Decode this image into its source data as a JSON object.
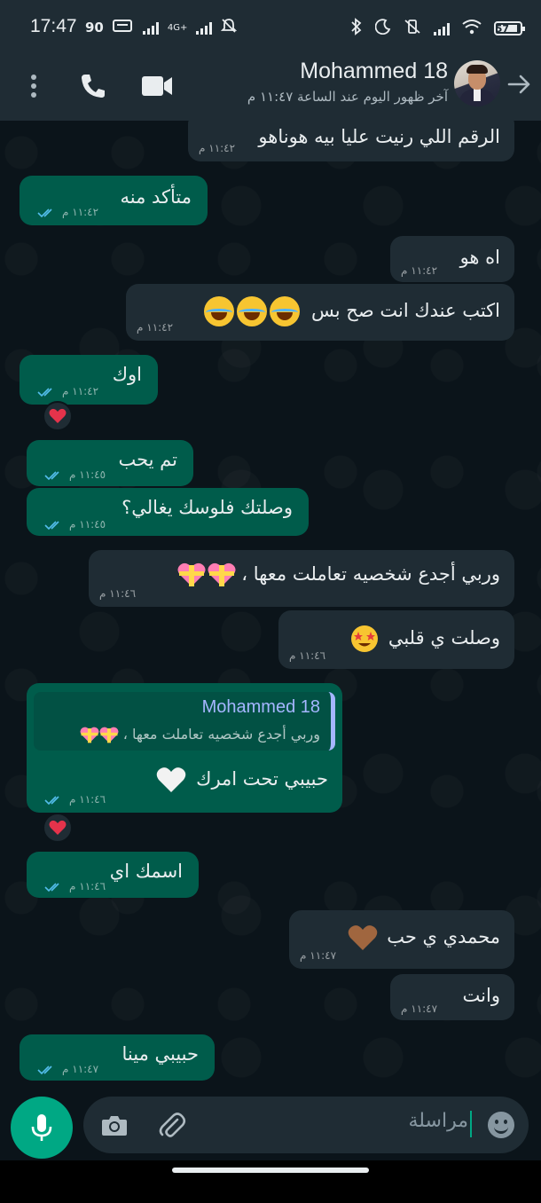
{
  "status_bar": {
    "time": "17:47",
    "left_extra": "90",
    "network_label": "4G+",
    "battery_label": "57"
  },
  "header": {
    "contact_name": "Mohammed 18",
    "last_seen": "آخر ظهور اليوم عند الساعة ١١:٤٧ م"
  },
  "messages": [
    {
      "direction": "incoming",
      "text": "الرقم اللي رنيت عليا بيه هوناهو",
      "time": "١١:٤٢ م"
    },
    {
      "direction": "outgoing",
      "text": "متأكد منه",
      "time": "١١:٤٢ م",
      "status": "read"
    },
    {
      "direction": "incoming",
      "text": "اه هو",
      "time": "١١:٤٢ م"
    },
    {
      "direction": "incoming",
      "text": "اكتب عندك انت صح بس",
      "time": "١١:٤٢ م",
      "emoji": "😂😂😂"
    },
    {
      "direction": "outgoing",
      "text": "اوك",
      "time": "١١:٤٢ م",
      "status": "read",
      "reaction": "❤️"
    },
    {
      "direction": "outgoing",
      "text": "تم يحب",
      "time": "١١:٤٥ م",
      "status": "read"
    },
    {
      "direction": "outgoing",
      "text": "وصلتك فلوسك يغالي؟",
      "time": "١١:٤٥ م",
      "status": "read"
    },
    {
      "direction": "incoming",
      "text": "وربي أجدع شخصيه تعاملت معها ،",
      "time": "١١:٤٦ م",
      "emoji": "💝💝"
    },
    {
      "direction": "incoming",
      "text": "وصلت ي قلبي",
      "time": "١١:٤٦ م",
      "emoji": "🤩"
    },
    {
      "direction": "outgoing",
      "quote_author": "Mohammed 18",
      "quote_text": "وربي أجدع شخصيه تعاملت معها ،",
      "text": "حبيبي تحت امرك",
      "emoji": "🤍",
      "time": "١١:٤٦ م",
      "status": "read",
      "reaction": "❤️"
    },
    {
      "direction": "outgoing",
      "text": "اسمك اي",
      "time": "١١:٤٦ م",
      "status": "read"
    },
    {
      "direction": "incoming",
      "text": "محمدي ي حب",
      "emoji": "🤎",
      "time": "١١:٤٧ م"
    },
    {
      "direction": "incoming",
      "text": "وانت",
      "time": "١١:٤٧ م"
    },
    {
      "direction": "outgoing",
      "text": "حبيبي مينا",
      "time": "١١:٤٧ م",
      "status": "read"
    }
  ],
  "composer": {
    "placeholder": "مراسلة"
  },
  "colors": {
    "outgoing_bubble": "#005c4b",
    "incoming_bubble": "#1f2c34",
    "accent": "#00a884",
    "background": "#0b141a",
    "read_ticks": "#53bdeb"
  }
}
